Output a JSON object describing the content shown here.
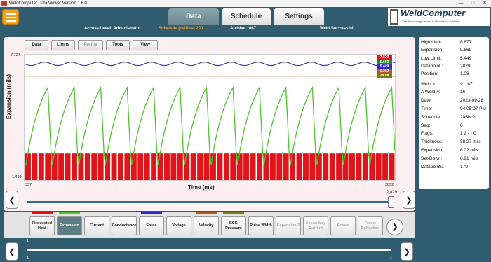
{
  "window": {
    "title": "WeldComputer Data Viewer Version 1.6.0"
  },
  "tabs": {
    "data": "Data",
    "schedule": "Schedule",
    "settings": "Settings"
  },
  "logo": {
    "text": "WeldComputer",
    "tagline": "The Technology Leader in Resistance Welding"
  },
  "status": {
    "access": "Access Level: Administrator",
    "schedule": "Schedule (calibre) 200",
    "archive": "Archive 1067",
    "weld": "Weld Successful"
  },
  "toolbar": {
    "data": "Data",
    "limits": "Limits",
    "profile": "Profile",
    "tools": "Tools",
    "view": "View"
  },
  "chart_data": {
    "type": "line",
    "ylabel": "Expansion (mils)",
    "xlabel": "Time (ms)",
    "xlim": [
      337,
      2852
    ],
    "ylim": [
      -1.499,
      7.727
    ],
    "x_tick_labels": [
      "337",
      "2852"
    ],
    "y_tick_labels": [
      "7.727",
      "-1.499"
    ],
    "marker_values": [
      {
        "value": "7.820",
        "color": "#e0151c"
      },
      {
        "value": "5.669",
        "color": "#1c8a1c"
      },
      {
        "value": "5.449",
        "color": "#2c2ad0"
      },
      {
        "value": "0.202",
        "color": "#b05a20"
      },
      {
        "value": "28.98",
        "color": "#7a7a10"
      }
    ],
    "series_colors": {
      "expansion": "#4ec42a",
      "high_limit": "#3e3a9a",
      "low_limit": "#b05a20",
      "requested_heat": "#e0151c"
    }
  },
  "slider": {
    "value": "2,829",
    "bottom_left": "1",
    "bottom_right": "1",
    "bottom_left_bottom": "1"
  },
  "legend": {
    "requested_heat": "Requested Heat",
    "expansion": "Expansion",
    "current": "Current",
    "conductance": "Conductance",
    "force": "Force",
    "voltage": "Voltage",
    "velocity": "Velocity",
    "ecg_pressure": "ECG Pressure",
    "pulse_width": "Pulse Width",
    "expansion2": "Expansion 2",
    "secondary_current": "Secondary Current",
    "power": "Power",
    "frame_deflection": "Frame Deflection"
  },
  "legend_colors": {
    "requested_heat": "#e0151c",
    "expansion": "#4ec42a",
    "force": "#2c2ad0",
    "velocity": "#b05a20",
    "ecg_pressure": "#7a7a10"
  },
  "side": {
    "high_limit": {
      "label": "High Limit:",
      "value": "6.677"
    },
    "expansion": {
      "label": "Expansion:",
      "value": "5.669"
    },
    "low_limit": {
      "label": "Low Limit:",
      "value": "5.449"
    },
    "datapoint": {
      "label": "Datapoint :",
      "value": "2829"
    },
    "position": {
      "label": "Position:",
      "value": "1.08"
    },
    "weld_no": {
      "label": "Weld #:",
      "value": "91167"
    },
    "a_weld_no": {
      "label": "A Weld #:",
      "value": "16"
    },
    "date": {
      "label": "Date:",
      "value": "2023-09-28"
    },
    "time": {
      "label": "Time:",
      "value": "04:05:07 PM"
    },
    "schedule": {
      "label": "Schedule:",
      "value": "205bc2l"
    },
    "seq": {
      "label": "Seq:",
      "value": "0"
    },
    "flags": {
      "label": "Flags:",
      "value": "1 2 - - C"
    },
    "thickness": {
      "label": "Thickness:",
      "value": "38.27 mils"
    },
    "expansion2": {
      "label": "Expansion:",
      "value": "6.02 mils"
    },
    "setdown": {
      "label": "Set-Down:",
      "value": "0.91 mils"
    },
    "datapoints": {
      "label": "Datapoints:",
      "value": "179"
    }
  }
}
